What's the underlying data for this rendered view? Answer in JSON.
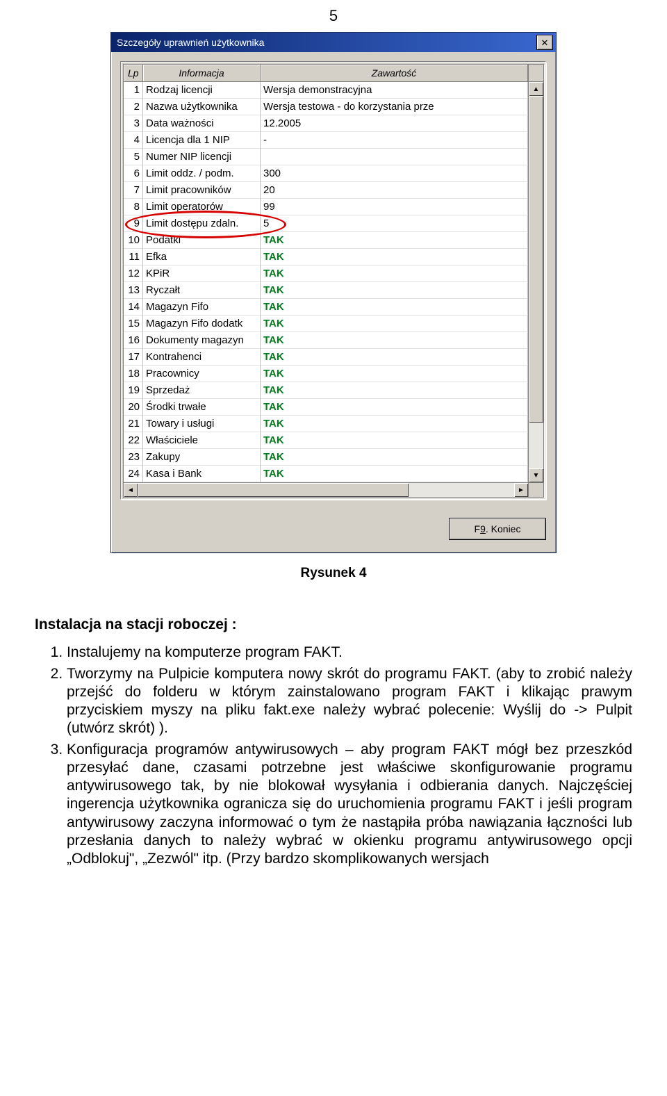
{
  "page_number": "5",
  "window": {
    "title": "Szczegóły uprawnień użytkownika",
    "columns": {
      "lp": "Lp",
      "info": "Informacja",
      "value": "Zawartość"
    },
    "rows": [
      {
        "lp": "1",
        "info": "Rodzaj licencji",
        "value": "Wersja demonstracyjna"
      },
      {
        "lp": "2",
        "info": "Nazwa użytkownika",
        "value": "Wersja testowa - do korzystania prze"
      },
      {
        "lp": "3",
        "info": "Data ważności",
        "value": "12.2005"
      },
      {
        "lp": "4",
        "info": "Licencja dla 1 NIP",
        "value": "-"
      },
      {
        "lp": "5",
        "info": "Numer NIP licencji",
        "value": ""
      },
      {
        "lp": "6",
        "info": "Limit oddz. / podm.",
        "value": "300"
      },
      {
        "lp": "7",
        "info": "Limit pracowników",
        "value": "20"
      },
      {
        "lp": "8",
        "info": "Limit operatorów",
        "value": "99"
      },
      {
        "lp": "9",
        "info": "Limit dostępu zdaln.",
        "value": "5"
      },
      {
        "lp": "10",
        "info": "Podatki",
        "value": "TAK",
        "tak": true
      },
      {
        "lp": "11",
        "info": "Efka",
        "value": "TAK",
        "tak": true
      },
      {
        "lp": "12",
        "info": "KPiR",
        "value": "TAK",
        "tak": true
      },
      {
        "lp": "13",
        "info": "Ryczałt",
        "value": "TAK",
        "tak": true
      },
      {
        "lp": "14",
        "info": "Magazyn Fifo",
        "value": "TAK",
        "tak": true
      },
      {
        "lp": "15",
        "info": "Magazyn Fifo dodatk",
        "value": "TAK",
        "tak": true
      },
      {
        "lp": "16",
        "info": "Dokumenty magazyn",
        "value": "TAK",
        "tak": true
      },
      {
        "lp": "17",
        "info": "Kontrahenci",
        "value": "TAK",
        "tak": true
      },
      {
        "lp": "18",
        "info": "Pracownicy",
        "value": "TAK",
        "tak": true
      },
      {
        "lp": "19",
        "info": "Sprzedaż",
        "value": "TAK",
        "tak": true
      },
      {
        "lp": "20",
        "info": "Środki trwałe",
        "value": "TAK",
        "tak": true
      },
      {
        "lp": "21",
        "info": "Towary i usługi",
        "value": "TAK",
        "tak": true
      },
      {
        "lp": "22",
        "info": "Właściciele",
        "value": "TAK",
        "tak": true
      },
      {
        "lp": "23",
        "info": "Zakupy",
        "value": "TAK",
        "tak": true
      },
      {
        "lp": "24",
        "info": "Kasa i Bank",
        "value": "TAK",
        "tak": true
      }
    ],
    "close_button_label": "F9. Koniec",
    "close_button_underline": "9",
    "highlight_row_index": 8
  },
  "figure_caption": "Rysunek 4",
  "text": {
    "heading": "Instalacja na stacji roboczej :",
    "items": [
      "Instalujemy na komputerze program FAKT.",
      "Tworzymy na Pulpicie komputera nowy skrót do programu FAKT. (aby to zrobić należy przejść do folderu w którym zainstalowano program FAKT i klikając prawym przyciskiem myszy na pliku fakt.exe należy wybrać polecenie: Wyślij do  -> Pulpit (utwórz skrót) ).",
      "Konfiguracja programów antywirusowych – aby program FAKT mógł bez przeszkód przesyłać dane, czasami potrzebne jest właściwe skonfigurowanie programu antywirusowego tak, by nie blokował wysyłania i odbierania danych. Najczęściej ingerencja użytkownika ogranicza się do uruchomienia programu FAKT i jeśli program antywirusowy zaczyna informować o tym że nastąpiła próba nawiązania łączności lub przesłania danych to należy wybrać w okienku programu antywirusowego opcji „Odblokuj\", „Zezwól\" itp. (Przy bardzo skomplikowanych wersjach"
    ]
  }
}
